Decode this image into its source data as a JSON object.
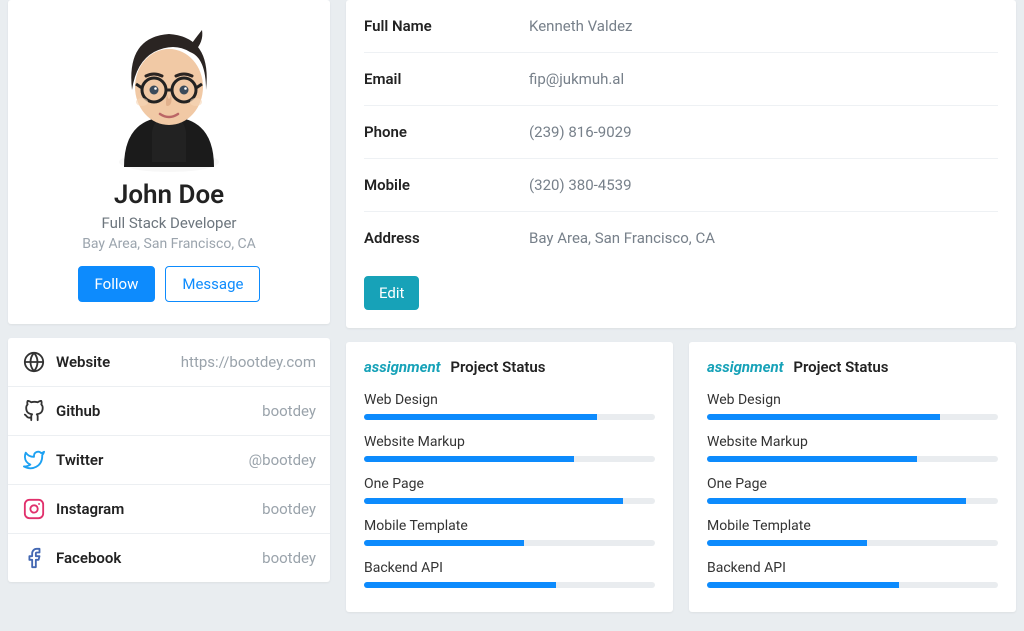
{
  "profile": {
    "name": "John Doe",
    "role": "Full Stack Developer",
    "location": "Bay Area, San Francisco, CA",
    "follow_label": "Follow",
    "message_label": "Message"
  },
  "links": [
    {
      "icon": "globe-icon",
      "label": "Website",
      "value": "https://bootdey.com"
    },
    {
      "icon": "github-icon",
      "label": "Github",
      "value": "bootdey"
    },
    {
      "icon": "twitter-icon",
      "label": "Twitter",
      "value": "@bootdey"
    },
    {
      "icon": "instagram-icon",
      "label": "Instagram",
      "value": "bootdey"
    },
    {
      "icon": "facebook-icon",
      "label": "Facebook",
      "value": "bootdey"
    }
  ],
  "details": {
    "fields": [
      {
        "label": "Full Name",
        "value": "Kenneth Valdez"
      },
      {
        "label": "Email",
        "value": "fip@jukmuh.al"
      },
      {
        "label": "Phone",
        "value": "(239) 816-9029"
      },
      {
        "label": "Mobile",
        "value": "(320) 380-4539"
      },
      {
        "label": "Address",
        "value": "Bay Area, San Francisco, CA"
      }
    ],
    "edit_label": "Edit"
  },
  "project_status": {
    "badge_text": "assignment",
    "title": "Project Status",
    "projects": [
      {
        "label": "Web Design",
        "percent": 80
      },
      {
        "label": "Website Markup",
        "percent": 72
      },
      {
        "label": "One Page",
        "percent": 89
      },
      {
        "label": "Mobile Template",
        "percent": 55
      },
      {
        "label": "Backend API",
        "percent": 66
      }
    ]
  },
  "colors": {
    "primary": "#0d8bfd",
    "teal": "#17a2b8"
  }
}
